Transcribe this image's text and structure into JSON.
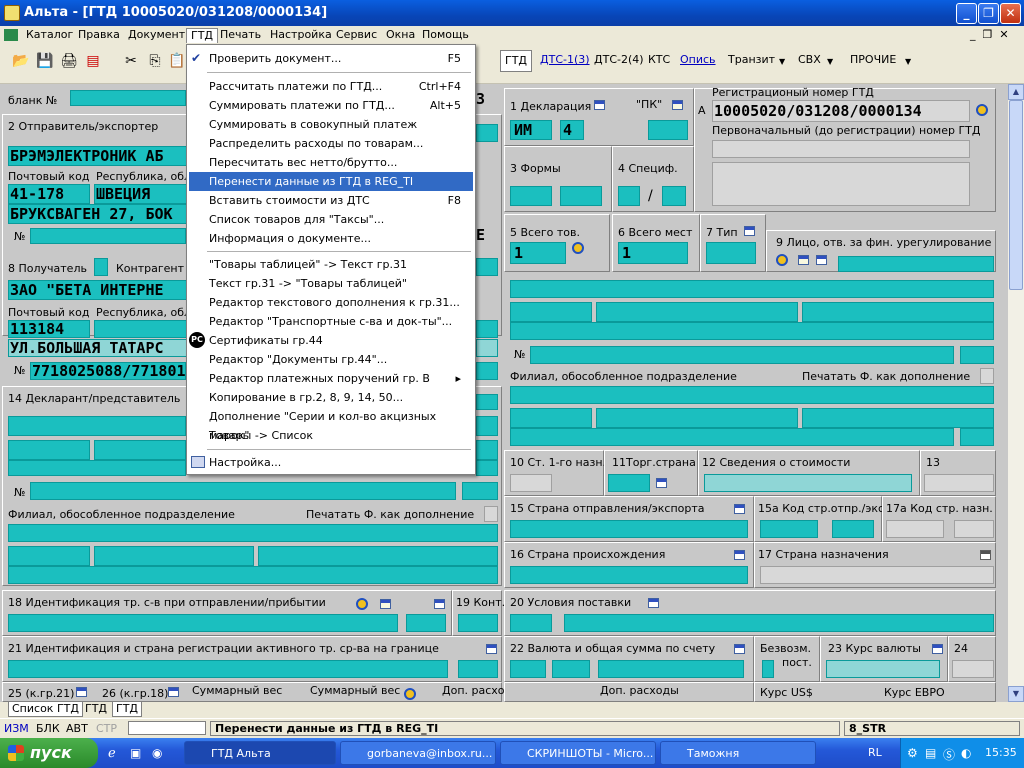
{
  "window": {
    "title": "Альта - [ГТД 10005020/031208/0000134]"
  },
  "menu": [
    "Каталог",
    "Правка",
    "Документ",
    "ГТД",
    "Печать",
    "Настройка",
    "Сервис",
    "Окна",
    "Помощь"
  ],
  "tabs": {
    "gtd": "ГТД",
    "dts1": "ДТС-1(3)",
    "dts2": "ДТС-2(4)",
    "kts": "КТС",
    "opis": "Опись",
    "tranzit": "Транзит",
    "svh": "СВХ",
    "prochie": "ПРОЧИЕ"
  },
  "dropdown": {
    "items": [
      {
        "label": "Проверить документ...",
        "shortcut": "F5"
      },
      {
        "label": "Рассчитать платежи по ГТД...",
        "shortcut": "Ctrl+F4"
      },
      {
        "label": "Суммировать платежи по ГТД...",
        "shortcut": "Alt+5"
      },
      {
        "label": "Суммировать в совокупный платеж",
        "shortcut": ""
      },
      {
        "label": "Распределить расходы по товарам...",
        "shortcut": ""
      },
      {
        "label": "Пересчитать вес нетто/брутто...",
        "shortcut": ""
      },
      {
        "label": "Перенести данные из ГТД в REG_TI",
        "shortcut": ""
      },
      {
        "label": "Вставить стоимости из ДТС",
        "shortcut": "F8"
      },
      {
        "label": "Список товаров для \"Таксы\"...",
        "shortcut": ""
      },
      {
        "label": "Информация о документе...",
        "shortcut": ""
      },
      {
        "label": "\"Товары таблицей\" -> Текст гр.31",
        "shortcut": ""
      },
      {
        "label": "Текст гр.31 -> \"Товары таблицей\"",
        "shortcut": ""
      },
      {
        "label": "Редактор текстового дополнения к гр.31...",
        "shortcut": ""
      },
      {
        "label": "Редактор \"Транспортные с-ва и док-ты\"...",
        "shortcut": ""
      },
      {
        "label": "Сертификаты гр.44",
        "shortcut": ""
      },
      {
        "label": "Редактор \"Документы гр.44\"...",
        "shortcut": ""
      },
      {
        "label": "Редактор платежных поручений гр. В",
        "shortcut": ""
      },
      {
        "label": "Копирование в гр.2, 8, 9, 14, 50...",
        "shortcut": ""
      },
      {
        "label": "Дополнение \"Серии и кол-во акцизных марок\"",
        "shortcut": ""
      },
      {
        "label": "Товары -> Список",
        "shortcut": ""
      },
      {
        "label": "Настройка...",
        "shortcut": ""
      }
    ]
  },
  "form": {
    "blank": "бланк №",
    "g2": "2 Отправитель/экспортер",
    "sender_name": "БРЭМЭЛЕКТРОНИК АБ",
    "postcode_lbl": "Почтовый код",
    "republic_lbl": "Республика, обла",
    "sender_zip": "41-178",
    "sender_country": "ШВЕЦИЯ",
    "sender_street": "БРУКСВАГЕН 27, БОК",
    "no": "№",
    "g8": "8 Получатель",
    "contragent": "Контрагент",
    "recv_name": "ЗАО \"БЕТА ИНТЕРНЕ",
    "recv_zip": "113184",
    "recv_street": "УЛ.БОЛЬШАЯ ТАТАРС",
    "recv_inn": "7718025088/771801",
    "g14": "14 Декларант/представитель",
    "filial": "Филиал, обособленное подразделение",
    "print_add": "Печатать Ф. как дополнение",
    "g18": "18 Идентификация тр. с-в при отправлении/прибытии",
    "g19": "19 Конт.",
    "g21": "21 Идентификация и страна регистрации активного тр. ср-ва на границе",
    "g25": "25 (к.гр.21)",
    "g26": "26 (к.гр.18)",
    "sumweight1": "Суммарный вес",
    "sumweight2": "Суммарный вес",
    "addexp1": "Доп. расходы",
    "addexp2": "Доп. расходы",
    "g1": "1 Декларация",
    "pk": "\"ПК\"",
    "im": "ИМ",
    "four": "4",
    "g3": "3 Формы",
    "g4": "4 Специф.",
    "slash": "/",
    "g5": "5 Всего тов.",
    "g6": "6 Всего мест",
    "g7": "7 Тип",
    "g5val": "1",
    "g6val": "1",
    "g9": "9 Лицо, отв. за фин. урегулирование",
    "reg_lbl": "Регистрационый номер ГТД",
    "reg_a": "А",
    "reg_num": "10005020/031208/0000134",
    "first_num": "Первоначальный (до регистрации) номер ГТД",
    "g10": "10 Ст. 1-го назн.",
    "g11": "11Торг.страна",
    "g12": "12 Сведения о стоимости",
    "g13": "13",
    "g15": "15 Страна отправления/экспорта",
    "g15a": "15а Код стр.отпр./экс.",
    "g17a": "17а Код стр. назн.",
    "g16": "16 Страна происхождения",
    "g17": "17 Страна назначения",
    "g20": "20 Условия поставки",
    "g22": "22 Валюта и общая сумма по счету",
    "free": "Безвозм.",
    "post": "пост.",
    "g23": "23 Курс валюты",
    "g24": "24",
    "usd": "Курс US$",
    "eur": "Курс ЕВРО",
    "num3": "3"
  },
  "bottom_tabs": [
    "Список ГТД",
    "ГТД",
    "ГТД"
  ],
  "status": {
    "izm": "ИЗМ",
    "blk": "БЛК",
    "avt": "АВТ",
    "str": "СТР",
    "msg": "Перенести данные из ГТД в REG_TI",
    "mode": "8_STR"
  },
  "taskbar": {
    "start": "пуск",
    "tasks": [
      "ГТД Альта",
      "gorbaneva@inbox.ru...",
      "СКРИНШОТЫ - Micro...",
      "Таможня"
    ],
    "lang": "RL",
    "time": "15:35"
  }
}
